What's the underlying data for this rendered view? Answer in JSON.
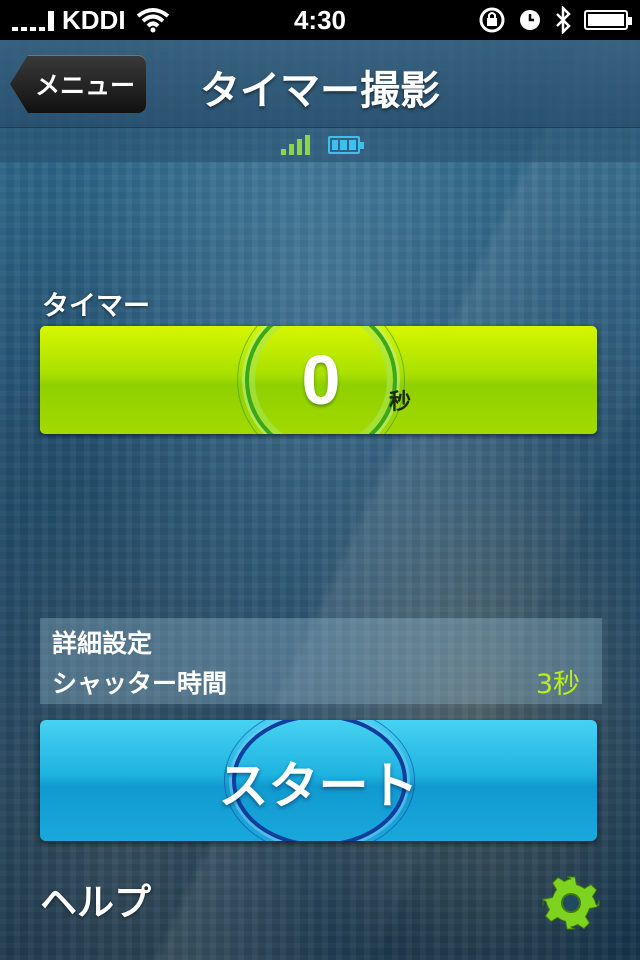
{
  "status_bar": {
    "carrier": "KDDI",
    "time": "4:30"
  },
  "nav": {
    "back_label": "メニュー",
    "title": "タイマー撮影"
  },
  "timer": {
    "label": "タイマー",
    "value": "0",
    "unit": "秒"
  },
  "details": {
    "title": "詳細設定",
    "shutter_label": "シャッター時間",
    "shutter_value": "3秒"
  },
  "start_button": {
    "label": "スタート"
  },
  "footer": {
    "help_label": "ヘルプ"
  },
  "icons": {
    "settings": "gear-icon",
    "device_signal": "signal-bars-icon",
    "device_battery": "battery-icon"
  },
  "colors": {
    "timer_green": "#a8e000",
    "start_blue": "#1eb3e0",
    "accent_green": "#8cd83a",
    "shutter_value": "#b9ee1a"
  }
}
